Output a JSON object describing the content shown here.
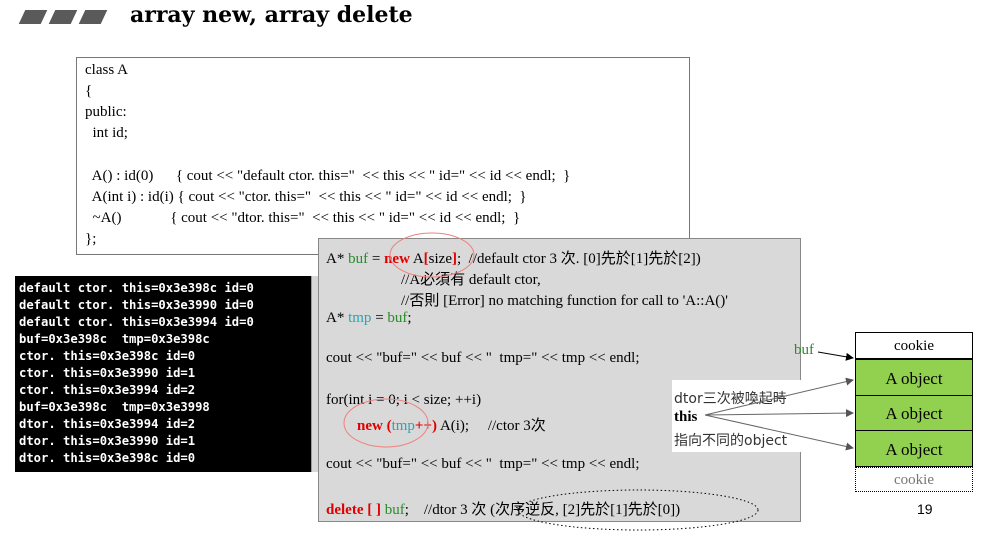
{
  "slide": {
    "title": "array new, array delete",
    "page_number": "19"
  },
  "code": {
    "lines": [
      "class A",
      "{",
      "public:",
      "  int id;",
      "",
      "  A() : id(0)      { cout << \"default ctor. this=\"  << this << \" id=\" << id << endl;  }",
      "  A(int i) : id(i) { cout << \"ctor. this=\"  << this << \" id=\" << id << endl;  }",
      "  ~A()             { cout << \"dtor. this=\"  << this << \" id=\" << id << endl;  }",
      "};"
    ]
  },
  "console": {
    "lines": [
      "default ctor. this=0x3e398c id=0",
      "default ctor. this=0x3e3990 id=0",
      "default ctor. this=0x3e3994 id=0",
      "buf=0x3e398c  tmp=0x3e398c",
      "ctor. this=0x3e398c id=0",
      "ctor. this=0x3e3990 id=1",
      "ctor. this=0x3e3994 id=2",
      "buf=0x3e398c  tmp=0x3e3998",
      "dtor. this=0x3e3994 id=2",
      "dtor. this=0x3e3990 id=1",
      "dtor. this=0x3e398c id=0"
    ]
  },
  "snippet": {
    "l1_a": "A* ",
    "l1_buf": "buf",
    "l1_b": " = ",
    "l1_new": "new",
    "l1_c": " A",
    "l1_lb": "[",
    "l1_d": "size",
    "l1_rb": "]",
    "l1_e": ";  //default ctor 3 次. [0]先於[1]先於[2])",
    "l2": "//A必須有 default ctor,",
    "l3": "//否則 [Error] no matching function for call to 'A::A()'",
    "l4_a": "A* ",
    "l4_tmp": "tmp",
    "l4_b": " = ",
    "l4_buf": "buf",
    "l4_c": ";",
    "l5": "cout << \"buf=\" << buf << \"  tmp=\" << tmp << endl;",
    "l6": "for(int i = 0; i < size; ++i)",
    "l7_new": "new (",
    "l7_tmp": "tmp",
    "l7_pp": "++)",
    "l7_b": " A(i);     //ctor 3次",
    "l8": "cout << \"buf=\" << buf << \"  tmp=\" << tmp << endl;",
    "l9_del": "delete [ ]",
    "l9_buf": " buf",
    "l9_a": ";    //dtor 3 次 (次序逆反, [2]先於[1]先於[0])"
  },
  "annotation": {
    "line1": "dtor三次被喚起時",
    "line2": "this",
    "line3": "指向不同的object"
  },
  "memory": {
    "pointer_label": "buf",
    "cells": [
      "cookie",
      "A object",
      "A object",
      "A object",
      "cookie"
    ]
  },
  "colors": {
    "keyword_red": "#e00000",
    "var_green": "#2a8c2a",
    "var_teal": "#2aa3b8",
    "object_green": "#92d050"
  }
}
